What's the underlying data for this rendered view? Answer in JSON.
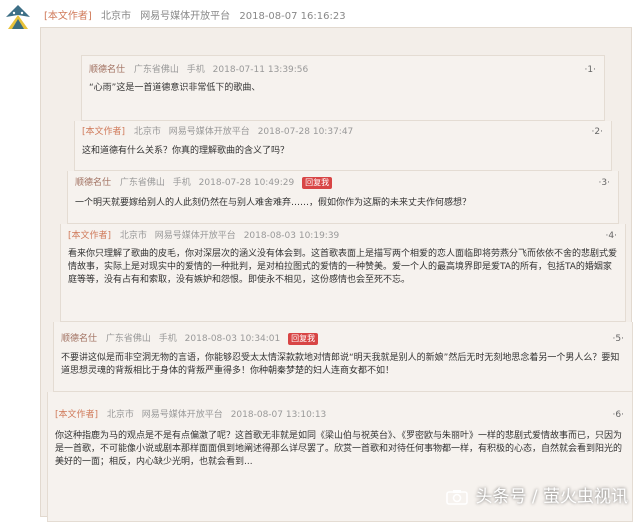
{
  "header": {
    "tag": "[本文作者]",
    "location": "北京市",
    "source": "网易号媒体开放平台",
    "time": "2018-08-07 16:16:23"
  },
  "comments": [
    {
      "user": "顺德名仕",
      "location": "广东省佛山",
      "source": "手机",
      "time": "2018-07-11 13:39:56",
      "floor": "·1·",
      "body": "“心雨”这是一首道德意识非常低下的歌曲、"
    },
    {
      "tag": "[本文作者]",
      "location": "北京市",
      "source": "网易号媒体开放平台",
      "time": "2018-07-28 10:37:47",
      "floor": "·2·",
      "body": "这和道德有什么关系？你真的理解歌曲的含义了吗？"
    },
    {
      "user": "顺德名仕",
      "location": "广东省佛山",
      "source": "手机",
      "time": "2018-07-28 10:49:29",
      "reply": "回复我",
      "floor": "·3·",
      "body": "一个明天就要嫁给别人的人此刻仍然在与别人难舍难弃……，假如你作为这厮的未来丈夫作何感想？"
    },
    {
      "tag": "[本文作者]",
      "location": "北京市",
      "source": "网易号媒体开放平台",
      "time": "2018-08-03 10:19:39",
      "floor": "·4·",
      "body": "看来你只理解了歌曲的皮毛，你对深层次的涵义没有体会到。这首歌表面上是描写两个相爱的恋人面临即将劳燕分飞而依依不舍的悲剧式爱情故事，实际上是对现实中的爱情的一种批判，是对柏拉图式的爱情的一种赞美。爱一个人的最高境界即是爱TA的所有，包括TA的婚姻家庭等等，没有占有和索取，没有嫉妒和怨恨。即使永不相见，这份感情也会至死不忘。"
    },
    {
      "user": "顺德名仕",
      "location": "广东省佛山",
      "source": "手机",
      "time": "2018-08-03 10:34:01",
      "reply": "回复我",
      "floor": "·5·",
      "body": "不要讲这似是而非空洞无物的言语，你能够忍受太太情深款款地对情郎说“明天我就是别人的新娘”然后无时无刻地思念着另一个男人么？要知道思想灵魂的背叛相比于身体的背叛严重得多！你种朝秦梦楚的妇人连商女都不如！"
    },
    {
      "tag": "[本文作者]",
      "location": "北京市",
      "source": "网易号媒体开放平台",
      "time": "2018-08-07 13:10:13",
      "floor": "·6·",
      "body": "你这种指鹿为马的观点是不是有点偏激了呢？这首歌无非就是如同《梁山伯与祝英台》、《罗密欧与朱丽叶》一样的悲剧式爱情故事而已，只因为是一首歌，不可能像小说或剧本那样面面俱到地阐述得那么详尽罢了。欣赏一首歌和对待任何事物都一样，有积极的心态，自然就会看到阳光的美好的一面；相反，内心缺少光明，也就会看到..."
    }
  ],
  "watermark": "头条号 / 萤火虫视讯",
  "colors": {
    "author_tag": "#d07a5a",
    "reply_badge": "#d84545",
    "panel_bg": "#f6f2ee"
  }
}
